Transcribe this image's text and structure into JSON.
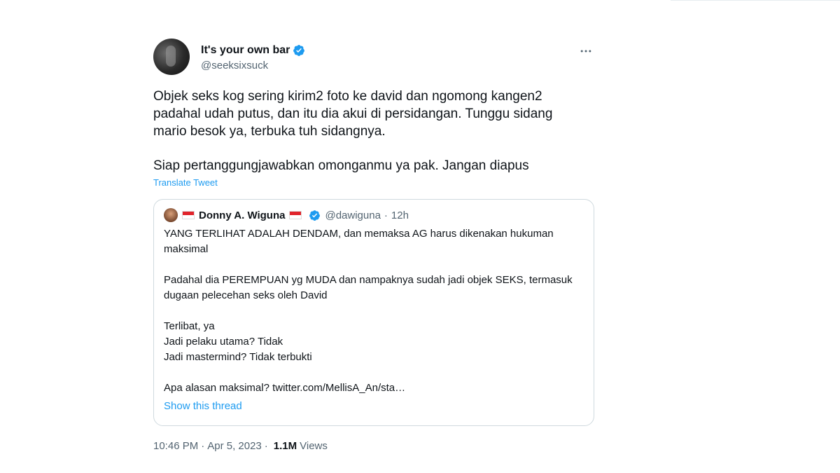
{
  "tweet": {
    "display_name": "It's your own bar",
    "handle": "@seeksixsuck",
    "paragraphs": [
      "Objek seks kog sering kirim2 foto ke david dan ngomong kangen2 padahal udah putus, dan itu dia akui di persidangan. Tunggu sidang mario besok ya, terbuka tuh sidangnya.",
      "Siap pertanggungjawabkan omonganmu ya pak. Jangan diapus"
    ],
    "translate_label": "Translate Tweet",
    "more_icon": "more-horizontal-icon",
    "time": "10:46 PM",
    "date": "Apr 5, 2023",
    "views_count": "1.1M",
    "views_label": "Views",
    "separator": "·"
  },
  "quote": {
    "display_name": "Donny A. Wiguna",
    "handle": "@dawiguna",
    "time": "12h",
    "separator": "·",
    "paragraphs": [
      [
        "YANG TERLIHAT ADALAH DENDAM, dan memaksa AG harus dikenakan hukuman maksimal"
      ],
      [
        "Padahal dia PEREMPUAN yg MUDA dan nampaknya sudah jadi objek SEKS, termasuk dugaan pelecehan seks oleh David"
      ],
      [
        "Terlibat, ya",
        "Jadi pelaku utama? Tidak",
        "Jadi mastermind? Tidak terbukti"
      ],
      [
        "Apa alasan maksimal? twitter.com/MellisA_An/sta…"
      ]
    ],
    "show_thread_label": "Show this thread"
  },
  "colors": {
    "accent": "#1d9bf0",
    "text": "#0f1419",
    "muted": "#536471",
    "border": "#cfd9de"
  }
}
